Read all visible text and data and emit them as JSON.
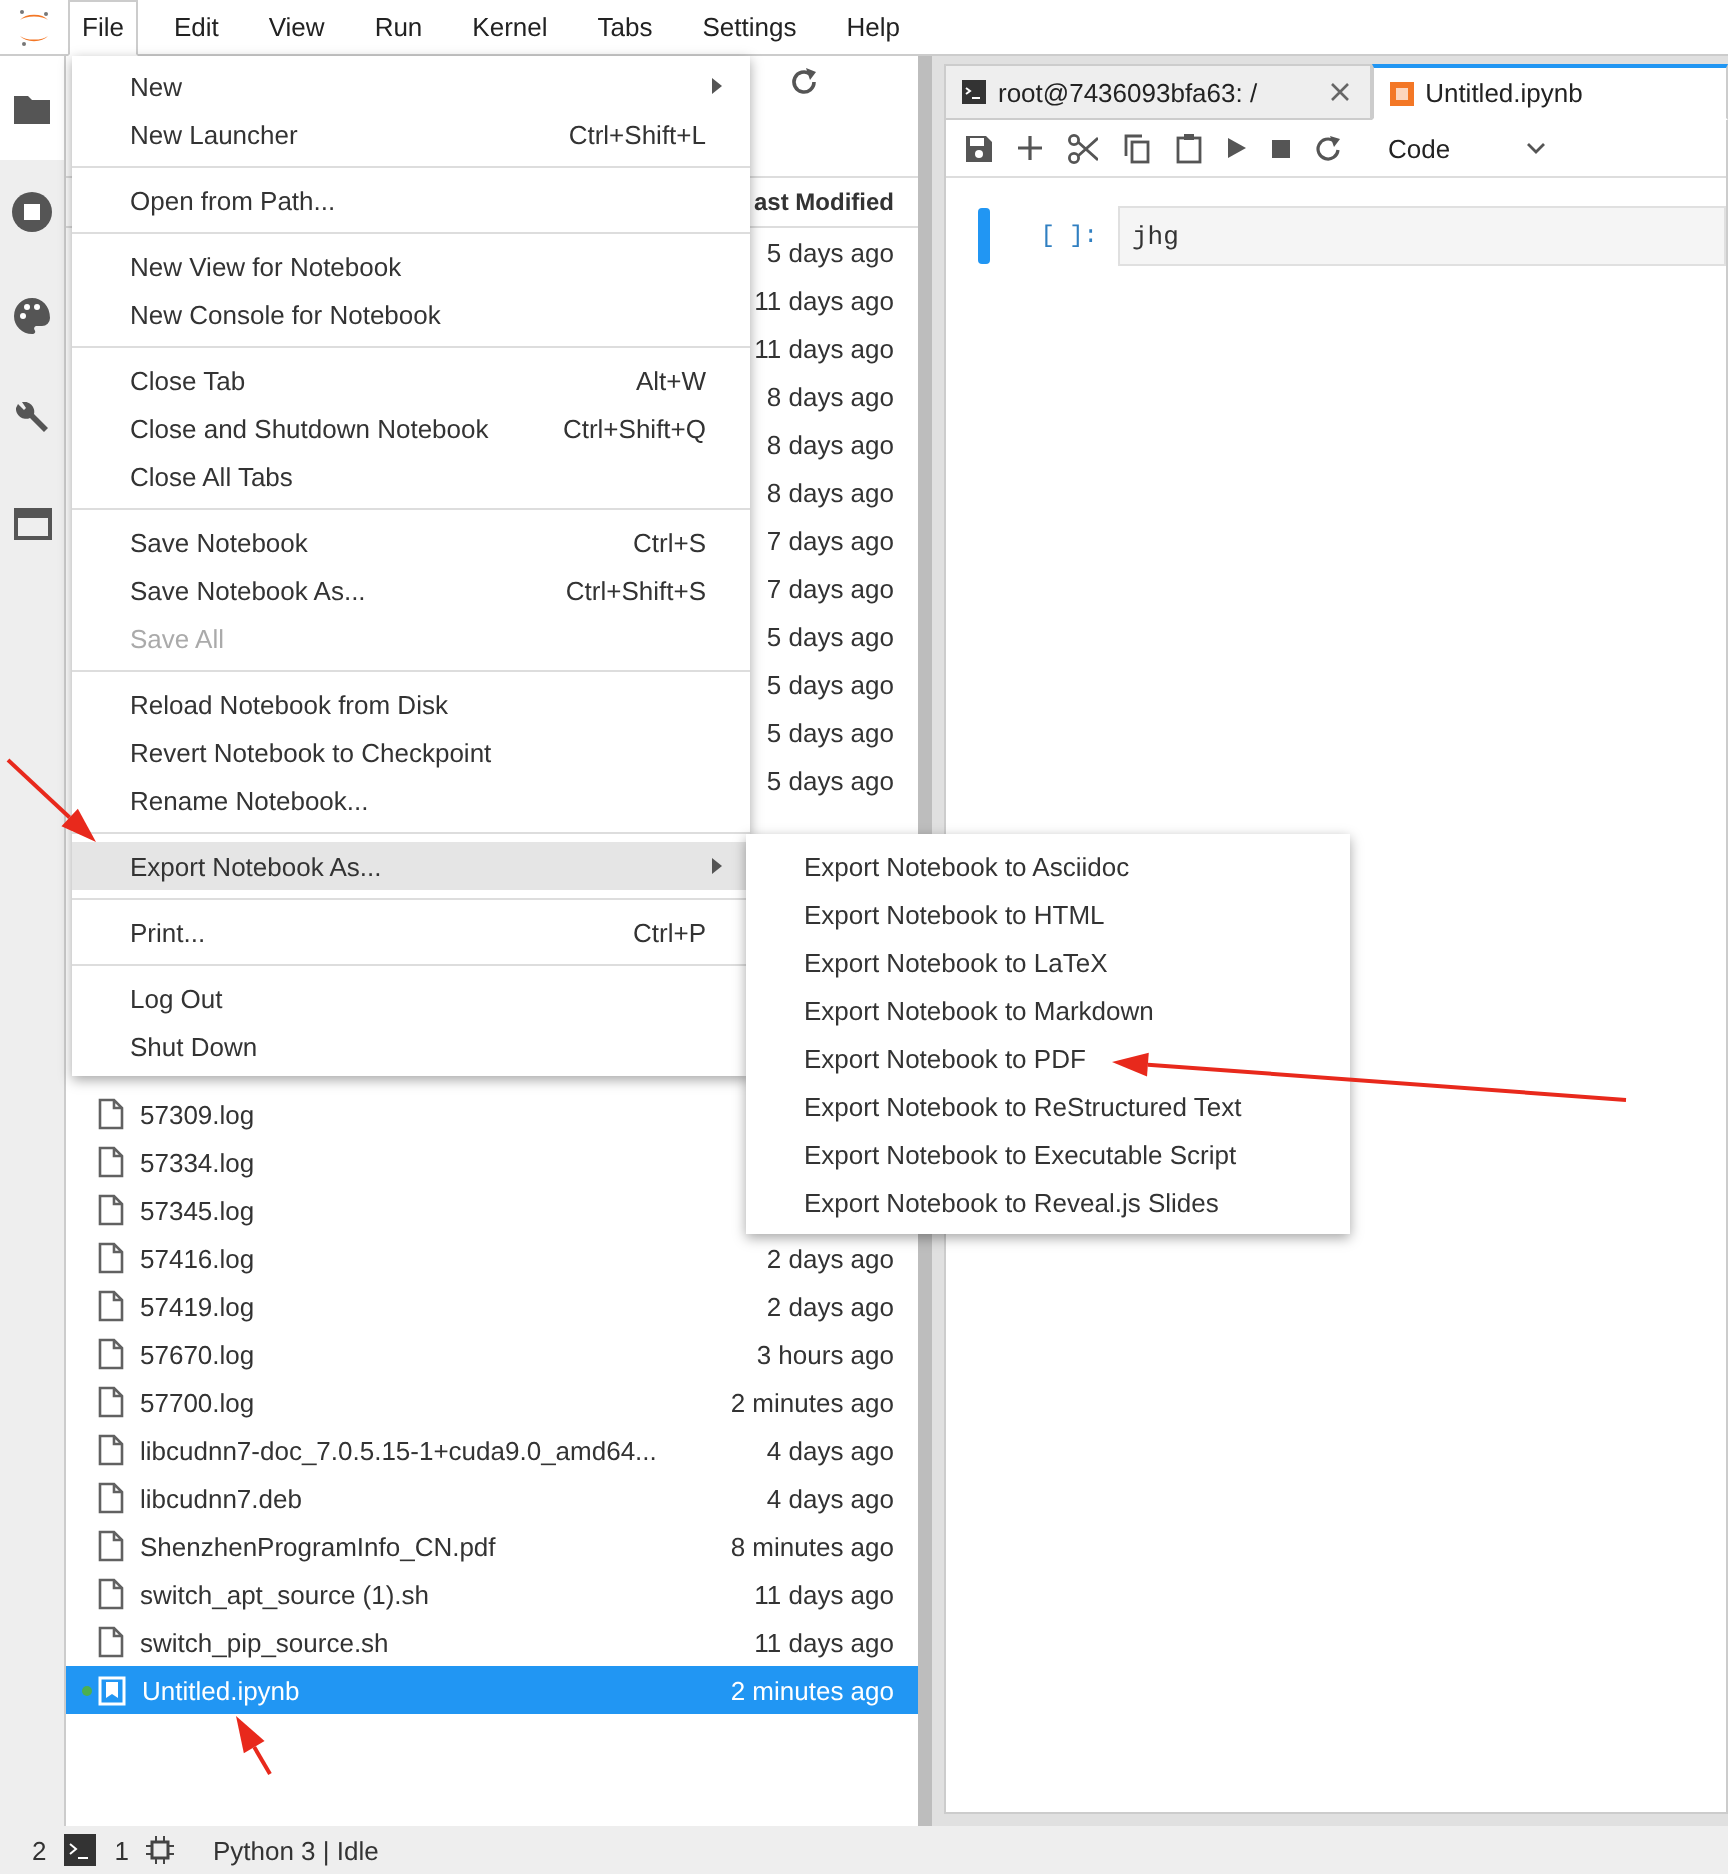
{
  "menubar": [
    {
      "label": "File",
      "selected": true
    },
    {
      "label": "Edit",
      "selected": false
    },
    {
      "label": "View",
      "selected": false
    },
    {
      "label": "Run",
      "selected": false
    },
    {
      "label": "Kernel",
      "selected": false
    },
    {
      "label": "Tabs",
      "selected": false
    },
    {
      "label": "Settings",
      "selected": false
    },
    {
      "label": "Help",
      "selected": false
    }
  ],
  "sidebar": {
    "items": [
      {
        "selected": true
      },
      {
        "selected": false
      },
      {
        "selected": false
      },
      {
        "selected": false
      },
      {
        "selected": false
      }
    ]
  },
  "file_browser": {
    "header": "ast Modified",
    "top_rows": [
      {
        "date": "5 days ago"
      },
      {
        "date": "11 days ago"
      },
      {
        "date": "11 days ago"
      },
      {
        "date": "8 days ago"
      },
      {
        "date": "8 days ago"
      },
      {
        "date": "8 days ago"
      },
      {
        "date": "7 days ago"
      },
      {
        "date": "7 days ago"
      },
      {
        "date": "5 days ago"
      },
      {
        "date": "5 days ago"
      },
      {
        "date": "5 days ago"
      },
      {
        "date": "5 days ago"
      }
    ],
    "bottom_rows": [
      {
        "name": "57309.log",
        "kind": "file",
        "selected": false,
        "running": false
      },
      {
        "name": "57334.log",
        "kind": "file",
        "selected": false,
        "running": false
      },
      {
        "name": "57345.log",
        "kind": "file",
        "selected": false,
        "running": false
      },
      {
        "name": "57416.log",
        "date": "2 days ago",
        "kind": "file",
        "selected": false,
        "running": false
      },
      {
        "name": "57419.log",
        "date": "2 days ago",
        "kind": "file",
        "selected": false,
        "running": false
      },
      {
        "name": "57670.log",
        "date": "3 hours ago",
        "kind": "file",
        "selected": false,
        "running": false
      },
      {
        "name": "57700.log",
        "date": "2 minutes ago",
        "kind": "file",
        "selected": false,
        "running": false
      },
      {
        "name": "libcudnn7-doc_7.0.5.15-1+cuda9.0_amd64...",
        "date": "4 days ago",
        "kind": "file",
        "selected": false,
        "running": false
      },
      {
        "name": "libcudnn7.deb",
        "date": "4 days ago",
        "kind": "file",
        "selected": false,
        "running": false
      },
      {
        "name": "ShenzhenProgramInfo_CN.pdf",
        "date": "8 minutes ago",
        "kind": "file",
        "selected": false,
        "running": false
      },
      {
        "name": "switch_apt_source (1).sh",
        "date": "11 days ago",
        "kind": "file",
        "selected": false,
        "running": false
      },
      {
        "name": "switch_pip_source.sh",
        "date": "11 days ago",
        "kind": "file",
        "selected": false,
        "running": false
      },
      {
        "name": "Untitled.ipynb",
        "date": "2 minutes ago",
        "kind": "notebook",
        "selected": true,
        "running": true
      }
    ]
  },
  "tabs": [
    {
      "label": "root@7436093bfa63: /",
      "kind": "terminal",
      "selected": false
    },
    {
      "label": "Untitled.ipynb",
      "kind": "notebook",
      "selected": true
    }
  ],
  "toolbar": {
    "cell_type": "Code"
  },
  "cell": {
    "prompt": "[ ]:",
    "source": "jhg"
  },
  "file_menu": {
    "groups": [
      [
        {
          "label": "New",
          "submenu": true,
          "disabled": false,
          "selected": false
        },
        {
          "label": "New Launcher",
          "shortcut": "Ctrl+Shift+L",
          "disabled": false,
          "selected": false
        }
      ],
      [
        {
          "label": "Open from Path...",
          "disabled": false,
          "selected": false
        }
      ],
      [
        {
          "label": "New View for Notebook",
          "disabled": false,
          "selected": false
        },
        {
          "label": "New Console for Notebook",
          "disabled": false,
          "selected": false
        }
      ],
      [
        {
          "label": "Close Tab",
          "shortcut": "Alt+W",
          "disabled": false,
          "selected": false
        },
        {
          "label": "Close and Shutdown Notebook",
          "shortcut": "Ctrl+Shift+Q",
          "disabled": false,
          "selected": false
        },
        {
          "label": "Close All Tabs",
          "disabled": false,
          "selected": false
        }
      ],
      [
        {
          "label": "Save Notebook",
          "shortcut": "Ctrl+S",
          "disabled": false,
          "selected": false
        },
        {
          "label": "Save Notebook As...",
          "shortcut": "Ctrl+Shift+S",
          "disabled": false,
          "selected": false
        },
        {
          "label": "Save All",
          "disabled": true,
          "selected": false
        }
      ],
      [
        {
          "label": "Reload Notebook from Disk",
          "disabled": false,
          "selected": false
        },
        {
          "label": "Revert Notebook to Checkpoint",
          "disabled": false,
          "selected": false
        },
        {
          "label": "Rename Notebook...",
          "disabled": false,
          "selected": false
        }
      ],
      [
        {
          "label": "Export Notebook As...",
          "submenu": true,
          "disabled": false,
          "selected": true
        }
      ],
      [
        {
          "label": "Print...",
          "shortcut": "Ctrl+P",
          "disabled": false,
          "selected": false
        }
      ],
      [
        {
          "label": "Log Out",
          "disabled": false,
          "selected": false
        },
        {
          "label": "Shut Down",
          "disabled": false,
          "selected": false
        }
      ]
    ]
  },
  "export_submenu": [
    "Export Notebook to Asciidoc",
    "Export Notebook to HTML",
    "Export Notebook to LaTeX",
    "Export Notebook to Markdown",
    "Export Notebook to PDF",
    "Export Notebook to ReStructured Text",
    "Export Notebook to Executable Script",
    "Export Notebook to Reveal.js Slides"
  ],
  "status_bar": {
    "terminals": "2",
    "kernels": "1",
    "kernel_status": "Python 3 | Idle"
  }
}
